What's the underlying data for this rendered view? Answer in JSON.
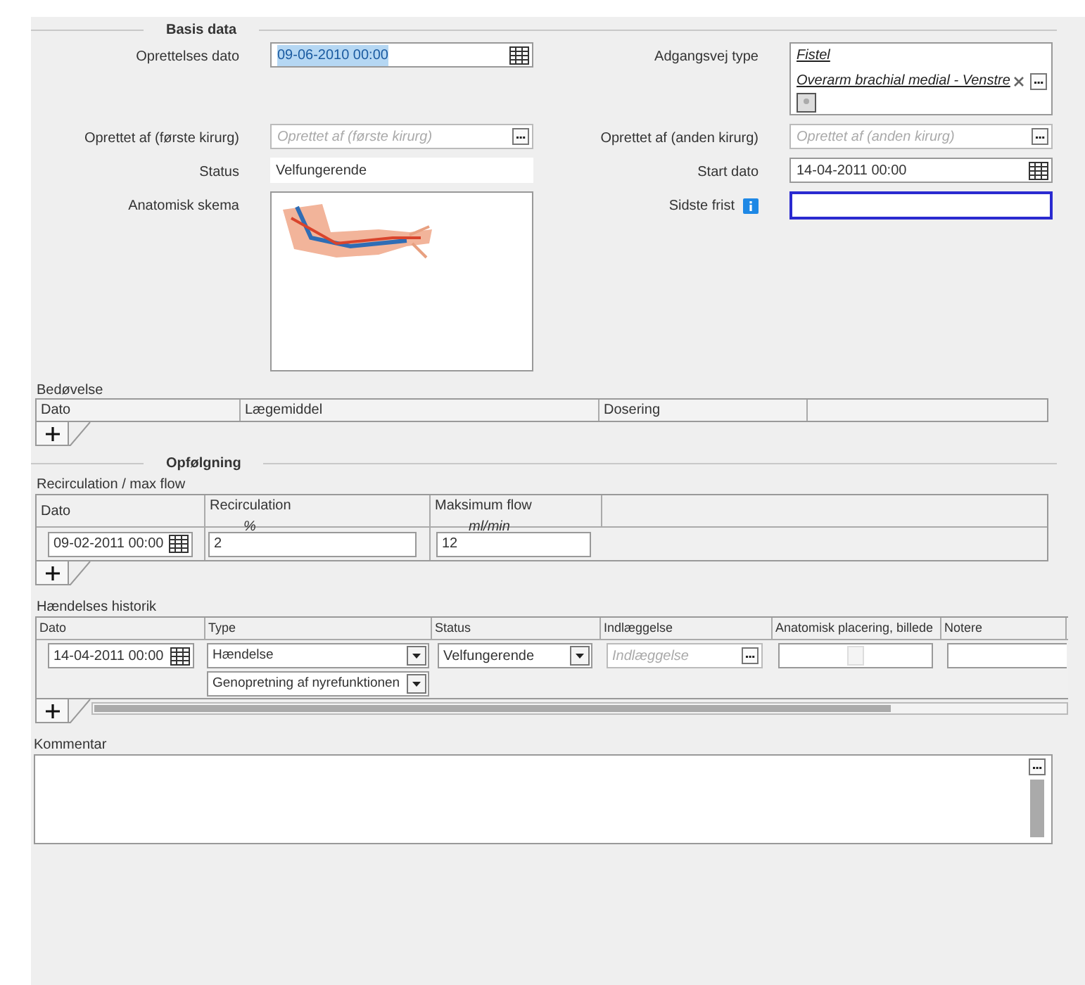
{
  "basis_data": {
    "title": "Basis data",
    "rows": [
      {
        "left": {
          "label": "Oprettelses dato",
          "kind": "date",
          "value": "09-06-2010 00:00",
          "text_selected": true
        },
        "right": {
          "label": "Adgangsvej type",
          "kind": "links",
          "links": [
            "Fistel",
            "Overarm brachial medial - Venstre"
          ]
        }
      },
      {
        "left": {
          "label": "Oprettet af (første kirurg)",
          "kind": "lookup",
          "placeholder": "Oprettet af (første kirurg)"
        },
        "right": {
          "label": "Oprettet af (anden kirurg)",
          "kind": "lookup",
          "placeholder": "Oprettet af (anden kirurg)"
        }
      },
      {
        "left": {
          "label": "Status",
          "kind": "readonly",
          "value": "Velfungerende"
        },
        "right": {
          "label": "Start dato",
          "kind": "date",
          "value": "14-04-2011 00:00",
          "text_selected": false
        }
      },
      {
        "left": {
          "label": "Anatomisk skema",
          "kind": "image"
        },
        "right": {
          "label": "Sidste frist",
          "kind": "text",
          "info": true,
          "focused": true
        }
      }
    ]
  },
  "anesthesia": {
    "title": "Bedøvelse",
    "columns": [
      "Dato",
      "Lægemiddel",
      "Dosering"
    ]
  },
  "followup": {
    "title": "Opfølgning",
    "recirculation": {
      "title": "Recirculation / max flow",
      "columns": [
        {
          "label": "Dato"
        },
        {
          "label": "Recirculation",
          "unit": "%"
        },
        {
          "label": "Maksimum flow",
          "unit": "ml/min"
        }
      ],
      "rows": [
        {
          "date": "09-02-2011 00:00",
          "recirculation": "2",
          "max_flow": "12"
        }
      ]
    },
    "history": {
      "title": "Hændelses historik",
      "columns": [
        "Dato",
        "Type",
        "Status",
        "Indlæggelse",
        "Anatomisk placering, billede",
        "Notere"
      ],
      "rows": [
        {
          "date": "14-04-2011 00:00",
          "type": "Hændelse",
          "subtype": "Genopretning af nyrefunktionen",
          "status": "Velfungerende",
          "admission_placeholder": "Indlæggelse"
        }
      ]
    },
    "comment": {
      "label": "Kommentar"
    }
  }
}
